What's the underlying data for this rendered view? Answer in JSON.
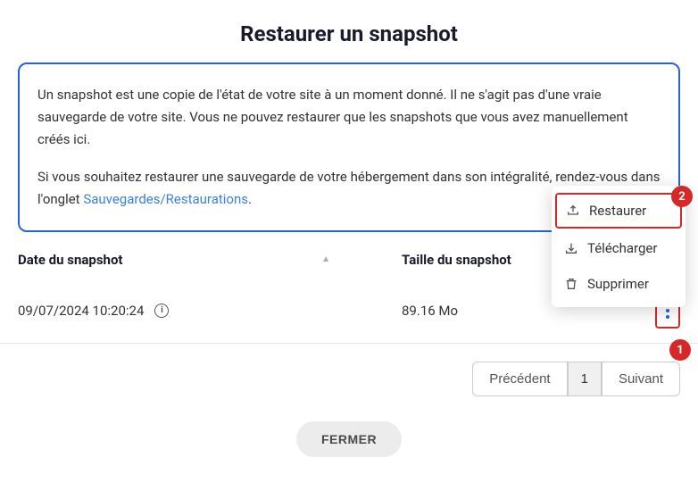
{
  "title": "Restaurer un snapshot",
  "info": {
    "p1": "Un snapshot est une copie de l'état de votre site à un moment donné. Il ne s'agit pas d'une vraie sauvegarde de votre site. Vous ne pouvez restaurer que les snapshots que vous avez manuellement créés ici.",
    "p2a": "Si vous souhaitez restaurer une sauvegarde de votre hébergement dans son intégralité, rendez-vous dans l'onglet ",
    "p2_link": "Sauvegardes/Restaurations",
    "p2b": "."
  },
  "table": {
    "header_date": "Date du snapshot",
    "header_size": "Taille du snapshot",
    "rows": [
      {
        "date": "09/07/2024 10:20:24",
        "size": "89.16 Mo"
      }
    ]
  },
  "dropdown": {
    "restore": "Restaurer",
    "download": "Télécharger",
    "delete": "Supprimer"
  },
  "annotations": {
    "step1": "1",
    "step2": "2"
  },
  "pagination": {
    "prev": "Précédent",
    "page": "1",
    "next": "Suivant"
  },
  "close": "FERMER"
}
